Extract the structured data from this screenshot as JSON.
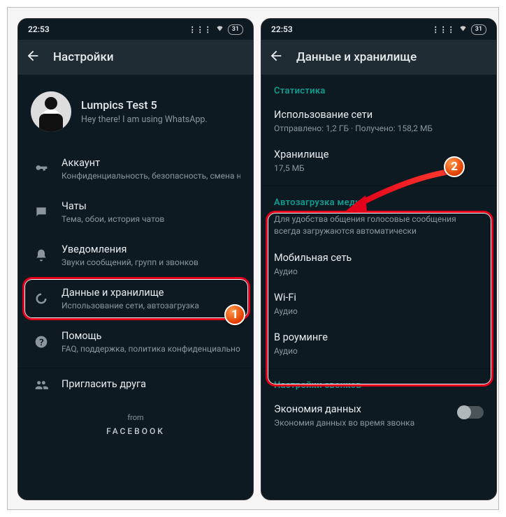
{
  "status": {
    "time": "22:53",
    "battery": "31"
  },
  "left": {
    "appbar_title": "Настройки",
    "profile": {
      "name": "Lumpics Test 5",
      "status": "Hey there! I am using WhatsApp."
    },
    "items": [
      {
        "title": "Аккаунт",
        "sub": "Конфиденциальность, безопасность, смена номера"
      },
      {
        "title": "Чаты",
        "sub": "Тема, обои, история чатов"
      },
      {
        "title": "Уведомления",
        "sub": "Звуки сообщений, групп и звонков"
      },
      {
        "title": "Данные и хранилище",
        "sub": "Использование сети, автозагрузка"
      },
      {
        "title": "Помощь",
        "sub": "FAQ, поддержка, политика конфиденциальности"
      },
      {
        "title": "Пригласить друга",
        "sub": ""
      }
    ],
    "footer": {
      "from": "from",
      "brand": "FACEBOOK"
    }
  },
  "right": {
    "appbar_title": "Данные и хранилище",
    "sections": {
      "stats": {
        "header": "Статистика",
        "network": {
          "title": "Использование сети",
          "sub": "Отправлено: 1,2 ГБ · Получено: 158,2 МБ"
        },
        "storage": {
          "title": "Хранилище",
          "sub": "17,5 МБ"
        }
      },
      "autodl": {
        "header": "Автозагрузка медиа",
        "desc": "Для удобства общения голосовые сообщения всегда загружаются автоматически",
        "items": [
          {
            "title": "Мобильная сеть",
            "sub": "Аудио"
          },
          {
            "title": "Wi-Fi",
            "sub": "Аудио"
          },
          {
            "title": "В роуминге",
            "sub": "Аудио"
          }
        ]
      },
      "calls": {
        "header": "Настройки звонков",
        "economy": {
          "title": "Экономия данных",
          "sub": "Экономия данных во время звонка"
        }
      }
    }
  },
  "badges": {
    "one": "1",
    "two": "2"
  }
}
